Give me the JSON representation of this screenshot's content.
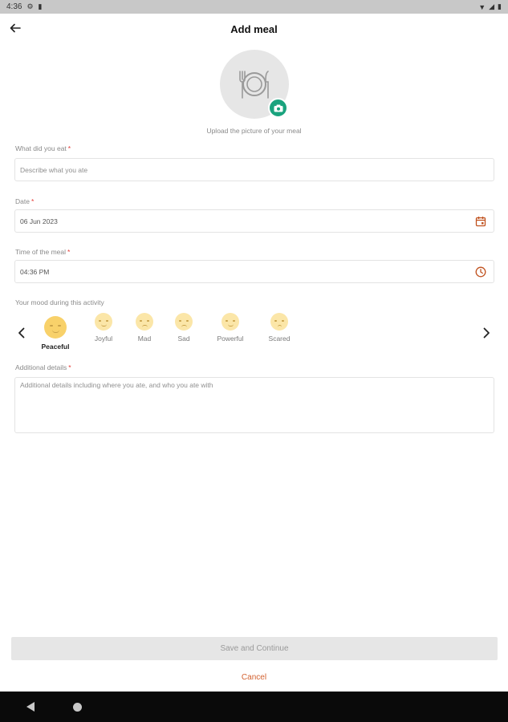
{
  "status_bar": {
    "time": "4:36",
    "icons": [
      "gear-icon",
      "sim-icon"
    ],
    "right_icons": [
      "wifi-icon",
      "signal-icon",
      "battery-icon"
    ]
  },
  "header": {
    "title": "Add meal",
    "back_icon": "arrow-left-icon"
  },
  "photo": {
    "hint": "Upload the picture of your meal",
    "placeholder_icon": "plate-cutlery-icon",
    "camera_icon": "camera-icon",
    "accent": "#1aa37e"
  },
  "form": {
    "meal": {
      "label": "What did you eat",
      "required": "*",
      "placeholder": "Describe what you ate"
    },
    "date": {
      "label": "Date",
      "required": "*",
      "value": "06 Jun 2023",
      "icon": "calendar-icon"
    },
    "time": {
      "label": "Time of the meal",
      "required": "*",
      "value": "04:36 PM",
      "icon": "clock-icon"
    },
    "mood": {
      "label": "Your mood during this activity",
      "selected": "Peaceful",
      "options": [
        {
          "label": "Peaceful"
        },
        {
          "label": "Joyful"
        },
        {
          "label": "Mad"
        },
        {
          "label": "Sad"
        },
        {
          "label": "Powerful"
        },
        {
          "label": "Scared"
        }
      ]
    },
    "details": {
      "label": "Additional details",
      "required": "*",
      "placeholder": "Additional details including where you ate, and who you ate with"
    }
  },
  "actions": {
    "save_label": "Save and Continue",
    "cancel_label": "Cancel",
    "cancel_color": "#d3612f"
  }
}
